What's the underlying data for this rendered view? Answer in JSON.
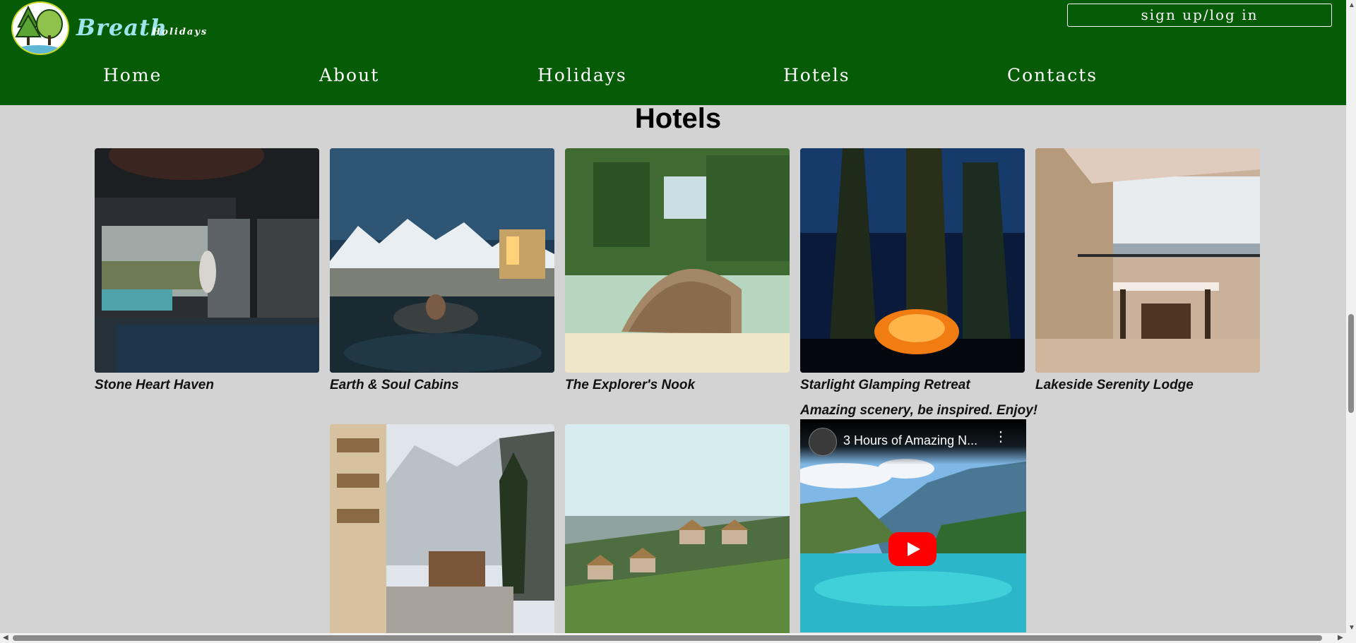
{
  "header": {
    "brand": "Breath",
    "brand_sub": "Holidays",
    "signup_label": "sign up/log in",
    "nav": [
      {
        "label": "Home"
      },
      {
        "label": "About"
      },
      {
        "label": "Holidays"
      },
      {
        "label": "Hotels"
      },
      {
        "label": "Contacts"
      }
    ],
    "accent_color": "#065c06"
  },
  "main": {
    "title": "Hotels",
    "hotels": [
      {
        "name": "Stone Heart Haven"
      },
      {
        "name": "Earth & Soul Cabins"
      },
      {
        "name": "The Explorer's Nook"
      },
      {
        "name": "Starlight Glamping Retreat"
      },
      {
        "name": "Lakeside Serenity Lodge"
      }
    ],
    "video": {
      "caption": "Amazing scenery, be inspired. Enjoy!",
      "title": "3 Hours of Amazing N...",
      "play_color": "#ff0000"
    }
  }
}
